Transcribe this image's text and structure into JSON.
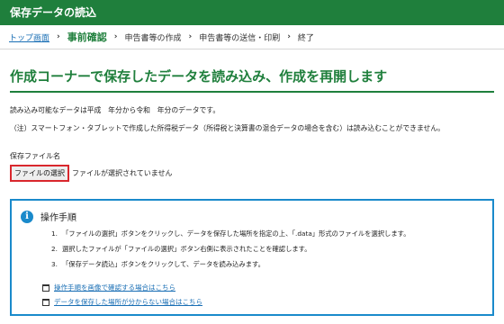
{
  "header": {
    "title": "保存データの読込"
  },
  "breadcrumb": {
    "home": "トップ画面",
    "current": "事前確認",
    "step3": "申告書等の作成",
    "step4": "申告書等の送信・印刷",
    "step5": "終了",
    "separator": "›"
  },
  "main": {
    "heading": "作成コーナーで保存したデータを読み込み、作成を再開します",
    "para1": "読み込み可能なデータは平成　年分から令和　年分のデータです。",
    "para2": "（注）スマートフォン・タブレットで作成した所得税データ（所得税と決算書の混合データの場合を含む）は読み込むことができません。",
    "field_label": "保存ファイル名",
    "file_button": "ファイルの選択",
    "file_status": "ファイルが選択されていません"
  },
  "panel": {
    "icon": "info-icon",
    "icon_glyph": "i",
    "title": "操作手順",
    "steps": [
      {
        "num": "1.",
        "text": "「ファイルの選択」ボタンをクリックし、データを保存した場所を指定の上、「.data」形式のファイルを選択します。"
      },
      {
        "num": "2.",
        "text": "選択したファイルが「ファイルの選択」ボタン右側に表示されたことを確認します。"
      },
      {
        "num": "3.",
        "text": "「保存データ読込」ボタンをクリックして、データを読み込みます。"
      }
    ],
    "links": [
      {
        "text": "操作手順を画像で確認する場合はこちら"
      },
      {
        "text": "データを保存した場所が分からない場合はこちら"
      }
    ]
  },
  "colors": {
    "brand_green": "#1f7f3c",
    "info_blue": "#1a8acb",
    "highlight_red": "#d9272d",
    "link_blue": "#1a6fb5"
  }
}
